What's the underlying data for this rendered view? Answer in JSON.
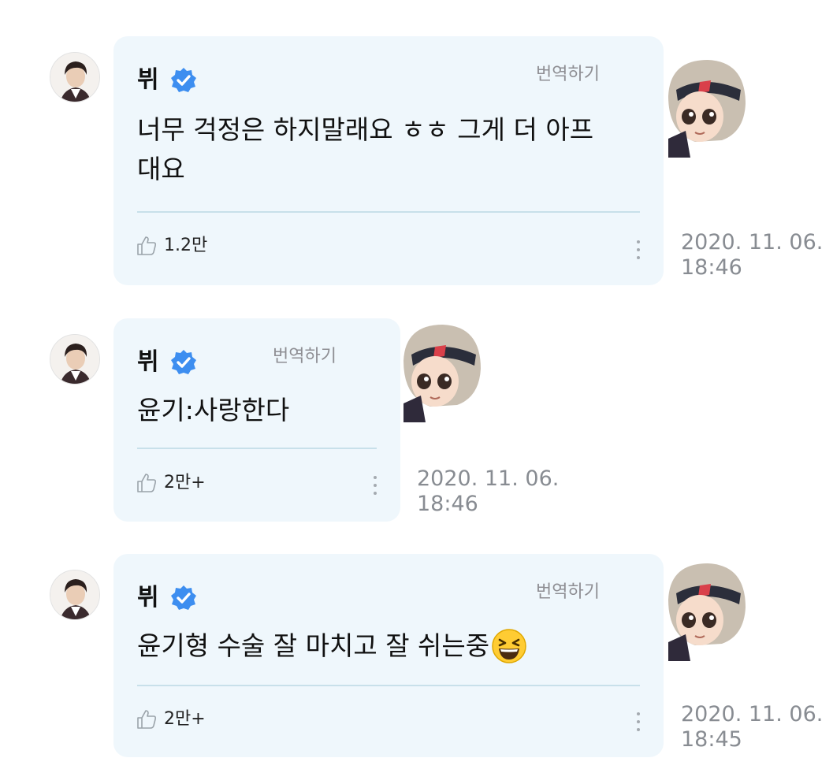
{
  "messages": [
    {
      "author": "뷔",
      "translate_label": "번역하기",
      "text": "너무 걱정은 하지말래요 ㅎㅎ 그게 더 아프\n대요",
      "likes": "1.2만",
      "date": "2020. 11. 06.",
      "time": "18:46"
    },
    {
      "author": "뷔",
      "translate_label": "번역하기",
      "text": "윤기:사랑한다",
      "likes": "2만+",
      "date": "2020. 11. 06.",
      "time": "18:46"
    },
    {
      "author": "뷔",
      "translate_label": "번역하기",
      "text": "윤기형 수술 잘 마치고 잘 쉬는중",
      "emoji": "😆",
      "likes": "2만+",
      "date": "2020. 11. 06.",
      "time": "18:45"
    }
  ],
  "icons": {
    "verified": "verified-badge-icon",
    "like": "thumbs-up-icon",
    "more": "vertical-dots-icon",
    "emoji": "laughing-face-icon"
  },
  "colors": {
    "bubble": "#eff7fc",
    "verified": "#3d8ef0",
    "divider": "#c8e0ea",
    "muted": "#8e8e93"
  }
}
